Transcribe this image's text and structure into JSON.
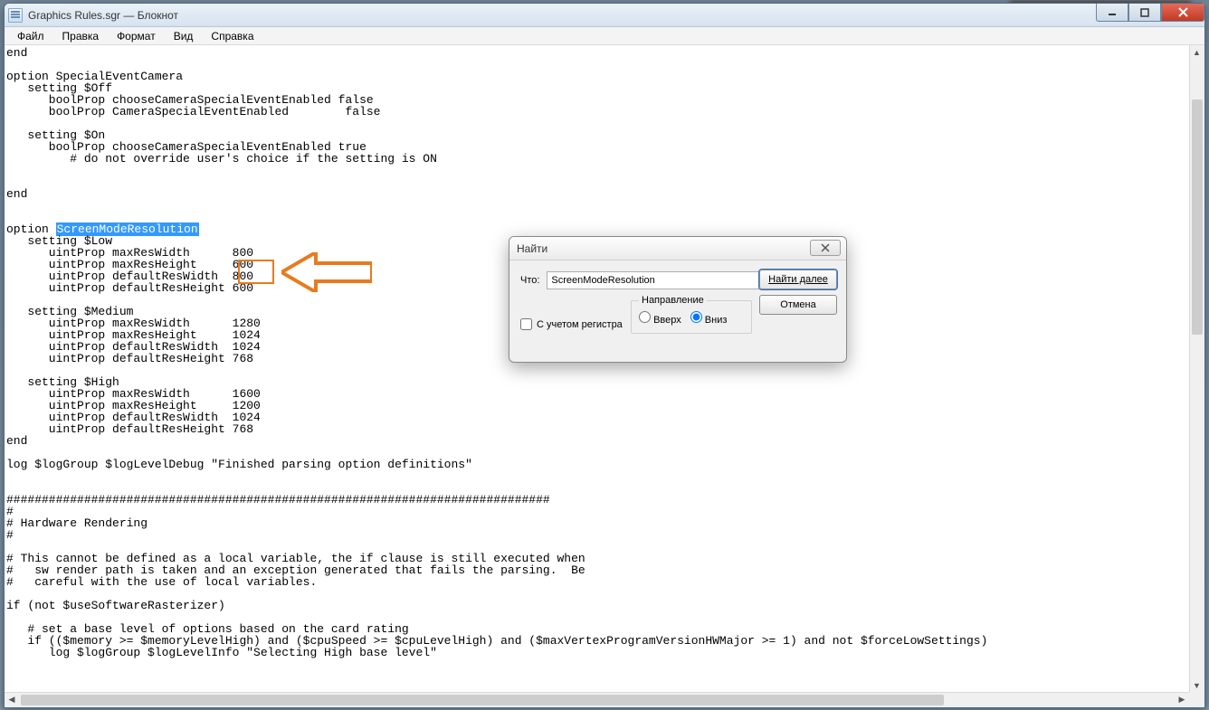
{
  "window": {
    "title": "Graphics Rules.sgr — Блокнот"
  },
  "menu": {
    "file": "Файл",
    "edit": "Правка",
    "format": "Формат",
    "view": "Вид",
    "help": "Справка"
  },
  "editor": {
    "pre1": "end\n\noption SpecialEventCamera\n   setting $Off\n      boolProp chooseCameraSpecialEventEnabled false\n      boolProp CameraSpecialEventEnabled        false\n\n   setting $On\n      boolProp chooseCameraSpecialEventEnabled true\n         # do not override user's choice if the setting is ON\n\n\nend\n\n\noption ",
    "highlight": "ScreenModeResolution",
    "post1": "\n   setting $Low\n      uintProp maxResWidth      800\n      uintProp maxResHeight     600\n      uintProp defaultResWidth  800\n      uintProp defaultResHeight 600\n\n   setting $Medium\n      uintProp maxResWidth      1280\n      uintProp maxResHeight     1024\n      uintProp defaultResWidth  1024\n      uintProp defaultResHeight 768\n\n   setting $High\n      uintProp maxResWidth      1600\n      uintProp maxResHeight     1200\n      uintProp defaultResWidth  1024\n      uintProp defaultResHeight 768\nend\n\nlog $logGroup $logLevelDebug \"Finished parsing option definitions\"\n\n\n#############################################################################\n#\n# Hardware Rendering\n#\n\n# This cannot be defined as a local variable, the if clause is still executed when\n#   sw render path is taken and an exception generated that fails the parsing.  Be\n#   careful with the use of local variables.\n\nif (not $useSoftwareRasterizer)\n\n   # set a base level of options based on the card rating\n   if (($memory >= $memoryLevelHigh) and ($cpuSpeed >= $cpuLevelHigh) and ($maxVertexProgramVersionHWMajor >= 1) and not $forceLowSettings)\n      log $logGroup $logLevelInfo \"Selecting High base level\"\n"
  },
  "find": {
    "title": "Найти",
    "what_label": "Что:",
    "what_value": "ScreenModeResolution",
    "find_next": "Найти далее",
    "cancel": "Отмена",
    "direction_label": "Направление",
    "up_label": "Вверх",
    "down_label": "Вниз",
    "match_case": "С учетом регистра",
    "direction_selected": "down",
    "match_case_checked": false
  },
  "annotation": {
    "box_values": [
      "800",
      "600"
    ]
  }
}
